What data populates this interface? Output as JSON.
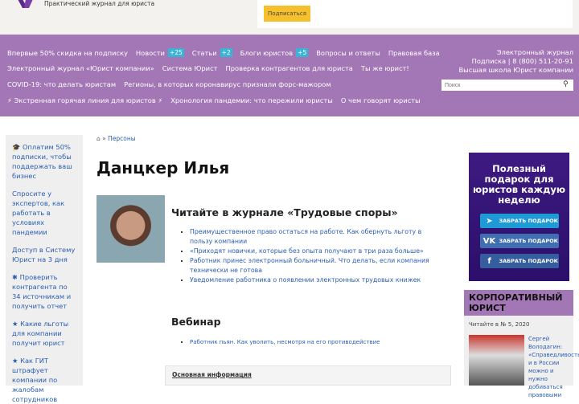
{
  "header": {
    "tagline": "Практический журнал для юриста",
    "subscribe_button": "Подписаться"
  },
  "nav": {
    "row1": [
      {
        "label": "Впервые 50% скидка на подписку"
      },
      {
        "label": "Новости",
        "badge": "+25"
      },
      {
        "label": "Статьи",
        "badge": "+2"
      },
      {
        "label": "Блоги юристов",
        "badge": "+5"
      },
      {
        "label": "Вопросы и ответы"
      },
      {
        "label": "Правовая база"
      }
    ],
    "row2": [
      "Электронный журнал «Юрист компании»",
      "Система Юрист",
      "Проверка контрагентов для юриста",
      "Ты же юрист!"
    ],
    "row3": [
      "COVID-19: что делать юристам",
      "Регионы, в которых коронавирус признали форс-мажором"
    ],
    "row4": [
      "⚡ Экстренная горячая линия для юристов ⚡",
      "Хронология пандемии: что пережили юристы",
      "О чем говорят юристы"
    ],
    "right": [
      "Электронный журнал",
      "Подписка | 8 (800) 511-20-91",
      "Высшая школа Юрист компании"
    ],
    "search_placeholder": "Поиск"
  },
  "sidebar": [
    "🎓 Оплатим 50% подписки, чтобы поддержать ваш бизнес",
    "Спросите у экспертов, как работать в условиях пандемии",
    "Доступ в Систему Юрист на 3 дня",
    "✱ Проверить контрагента по 34 источникам и получить отчет",
    "★ Какие льготы для компании получит юрист",
    "★ Как ГИТ штрафует компании по жалобам сотрудников"
  ],
  "breadcrumb": {
    "sep": "»",
    "link": "Персоны"
  },
  "title": "Данцкер Илья",
  "journal": {
    "heading": "Читайте в журнале «Трудовые споры»",
    "items": [
      "Преимущественное право остаться на работе. Как обернуть льготу в пользу компании",
      "«Приходят новички, которые без опыта получают в три раза больше»",
      "Работник принес электронный больничный. Что делать, если компания технически не готова",
      "Уведомление работника о появлении электронных трудовых книжек"
    ]
  },
  "webinar": {
    "heading": "Вебинар",
    "items": [
      "Работник пьян. Как уволить, несмотря на его противодействие"
    ]
  },
  "info_label": "Основная информация",
  "promo": {
    "title": "Полезный подарок для юристов каждую неделю",
    "buttons": [
      "ЗАБРАТЬ ПОДАРОК",
      "ЗАБРАТЬ ПОДАРОК",
      "ЗАБРАТЬ ПОДАРОК"
    ]
  },
  "corp": {
    "heading": "КОРПОРАТИВНЫЙ ЮРИСТ",
    "read_in": "Читайте в № 5, 2020",
    "article": "Сергей Володагин: «Справедливость и в России можно и нужно добиваться правовыми"
  }
}
